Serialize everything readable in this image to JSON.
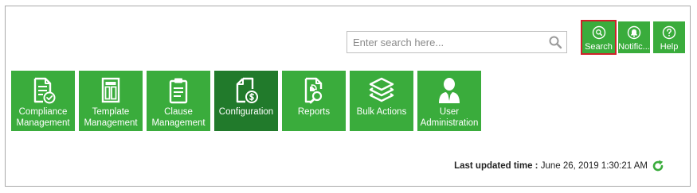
{
  "search": {
    "placeholder": "Enter search here...",
    "value": ""
  },
  "top_buttons": [
    {
      "label": "Search",
      "icon": "search-icon",
      "selected": true
    },
    {
      "label": "Notific...",
      "icon": "bell-icon",
      "selected": false
    },
    {
      "label": "Help",
      "icon": "help-icon",
      "selected": false
    }
  ],
  "tiles": [
    {
      "label_1": "Compliance",
      "label_2": "Management",
      "icon": "compliance-document-icon",
      "active": false
    },
    {
      "label_1": "Template",
      "label_2": "Management",
      "icon": "template-icon",
      "active": false
    },
    {
      "label_1": "Clause",
      "label_2": "Management",
      "icon": "clipboard-icon",
      "active": false
    },
    {
      "label_1": "Configuration",
      "label_2": "",
      "icon": "configuration-document-icon",
      "active": true
    },
    {
      "label_1": "Reports",
      "label_2": "",
      "icon": "report-search-icon",
      "active": false
    },
    {
      "label_1": "Bulk Actions",
      "label_2": "",
      "icon": "layers-icon",
      "active": false
    },
    {
      "label_1": "User",
      "label_2": "Administration",
      "icon": "user-admin-icon",
      "active": false
    }
  ],
  "status": {
    "updated_label": "Last updated time :",
    "updated_value": "June 26, 2019 1:30:21 AM",
    "refresh_icon": "refresh-icon"
  },
  "colors": {
    "tile_green": "#3aac3c",
    "tile_active": "#217a2b",
    "selected_outline": "#d0202a"
  }
}
